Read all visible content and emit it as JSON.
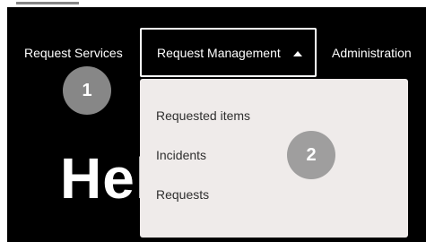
{
  "nav": {
    "items": [
      {
        "label": "Request Services"
      },
      {
        "label": "Request Management"
      },
      {
        "label": "Administration"
      }
    ]
  },
  "dropdown": {
    "items": [
      {
        "label": "Requested items"
      },
      {
        "label": "Incidents"
      },
      {
        "label": "Requests"
      }
    ]
  },
  "hero": {
    "text": "Hello Bob!"
  },
  "callouts": [
    {
      "number": "1"
    },
    {
      "number": "2"
    }
  ],
  "colors": {
    "header_bg": "#000000",
    "dropdown_bg": "#efebea",
    "callout": "#969696"
  },
  "icons": {
    "menu_caret": "caret-up-icon"
  }
}
